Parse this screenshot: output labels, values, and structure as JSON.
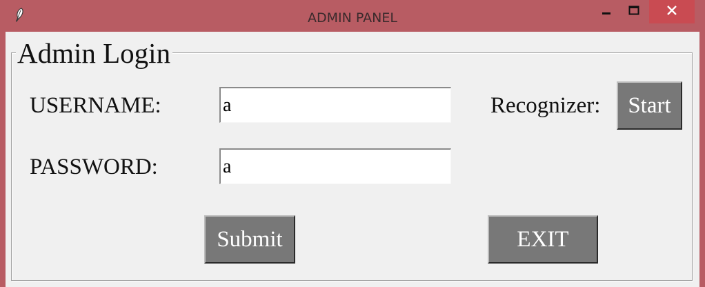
{
  "window": {
    "title": "ADMIN PANEL",
    "icon": "feather-icon",
    "controls": [
      "minimize-icon",
      "maximize-icon",
      "close-icon"
    ],
    "colors": {
      "titlebar": "#b85c63",
      "close_button": "#c94b52",
      "client": "#f0f0f0",
      "button": "#787878"
    }
  },
  "login": {
    "group_title": "Admin Login",
    "username_label": "USERNAME:",
    "username_value": "a",
    "password_label": "PASSWORD:",
    "password_value": "a",
    "recognizer_label": "Recognizer:",
    "start_label": "Start",
    "submit_label": "Submit",
    "exit_label": "EXIT"
  }
}
